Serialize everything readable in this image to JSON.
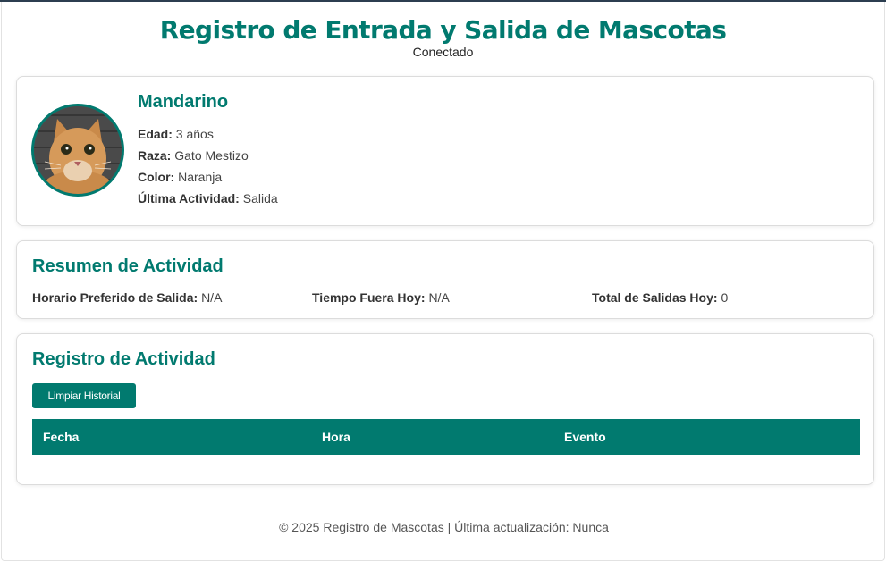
{
  "header": {
    "title": "Registro de Entrada y Salida de Mascotas",
    "status": "Conectado"
  },
  "pet": {
    "name": "Mandarino",
    "fields": [
      {
        "label": "Edad:",
        "value": "3 años"
      },
      {
        "label": "Raza:",
        "value": "Gato Mestizo"
      },
      {
        "label": "Color:",
        "value": "Naranja"
      },
      {
        "label": "Última Actividad:",
        "value": "Salida"
      }
    ]
  },
  "summary": {
    "title": "Resumen de Actividad",
    "items": [
      {
        "label": "Horario Preferido de Salida:",
        "value": "N/A"
      },
      {
        "label": "Tiempo Fuera Hoy:",
        "value": "N/A"
      },
      {
        "label": "Total de Salidas Hoy:",
        "value": "0"
      }
    ]
  },
  "log": {
    "title": "Registro de Actividad",
    "clear_label": "Limpiar Historial",
    "columns": [
      "Fecha",
      "Hora",
      "Evento"
    ],
    "rows": []
  },
  "footer": {
    "text": "© 2025 Registro de Mascotas | Última actualización: Nunca"
  },
  "colors": {
    "accent": "#017a6f",
    "text": "#444444"
  }
}
